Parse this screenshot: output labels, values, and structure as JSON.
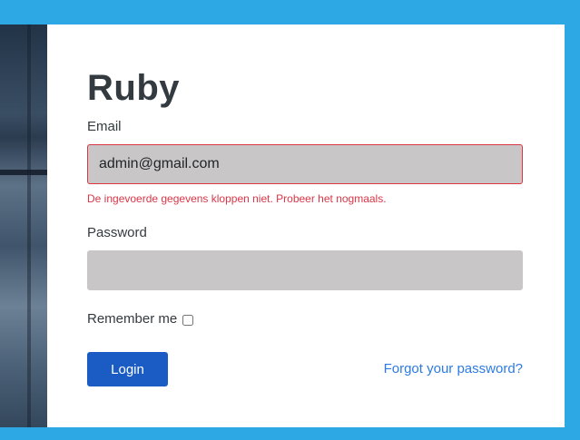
{
  "login": {
    "title": "Ruby",
    "email_label": "Email",
    "email_value": "admin@gmail.com",
    "error_message": "De ingevoerde gegevens kloppen niet. Probeer het nogmaals.",
    "password_label": "Password",
    "password_value": "",
    "remember_label": "Remember me",
    "remember_checked": false,
    "login_label": "Login",
    "forgot_label": "Forgot your password?"
  },
  "colors": {
    "page_background": "#2ea8e4",
    "card_background": "#ffffff",
    "input_fill": "#c8c6c7",
    "error": "#dc3545",
    "primary_button": "#1a5bc4",
    "link": "#2c7be5"
  }
}
